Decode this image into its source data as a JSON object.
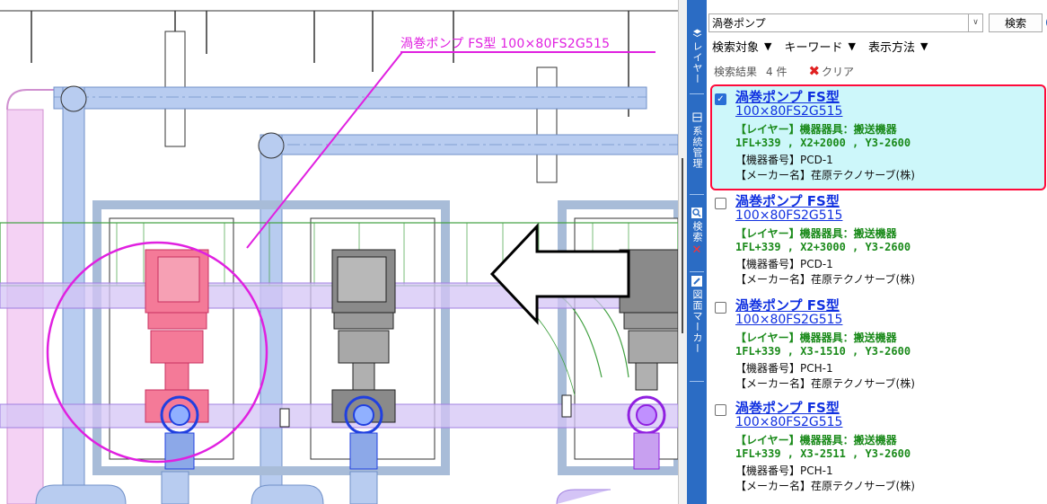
{
  "canvas": {
    "callout_label": "渦巻ポンプ FS型 100×80FS2G515",
    "colors": {
      "highlight": "#e020e0",
      "selected_pump": "#f07090",
      "pipe": "#a8c4ec",
      "duct": "#c8a8f0"
    }
  },
  "tabs": [
    {
      "label": "レイヤー",
      "icon": "layer-icon"
    },
    {
      "label": "系統管理",
      "icon": "system-icon"
    },
    {
      "label": "検索",
      "icon": "search-icon"
    },
    {
      "label": "図面マーカー",
      "icon": "marker-icon"
    }
  ],
  "search": {
    "query": "渦巻ポンプ",
    "button_label": "検索",
    "help_label": "?"
  },
  "filters": [
    {
      "label": "検索対象"
    },
    {
      "label": "キーワード"
    },
    {
      "label": "表示方法"
    }
  ],
  "results_header": {
    "label": "検索結果",
    "count": "4 件",
    "clear_label": "クリア"
  },
  "results": [
    {
      "title": "渦巻ポンプ FS型",
      "model": "100×80FS2G515",
      "layer": "【レイヤー】機器器具：搬送機器",
      "coord": "1FL+339 , X2+2000 , Y3-2600",
      "equip_no": "【機器番号】PCD-1",
      "maker": "【メーカー名】荏原テクノサーブ(株)",
      "checked": true
    },
    {
      "title": "渦巻ポンプ FS型",
      "model": "100×80FS2G515",
      "layer": "【レイヤー】機器器具：搬送機器",
      "coord": "1FL+339 , X2+3000 , Y3-2600",
      "equip_no": "【機器番号】PCD-1",
      "maker": "【メーカー名】荏原テクノサーブ(株)",
      "checked": false
    },
    {
      "title": "渦巻ポンプ FS型",
      "model": "100×80FS2G515",
      "layer": "【レイヤー】機器器具：搬送機器",
      "coord": "1FL+339 , X3-1510 , Y3-2600",
      "equip_no": "【機器番号】PCH-1",
      "maker": "【メーカー名】荏原テクノサーブ(株)",
      "checked": false
    },
    {
      "title": "渦巻ポンプ FS型",
      "model": "100×80FS2G515",
      "layer": "【レイヤー】機器器具：搬送機器",
      "coord": "1FL+339 , X3-2511 , Y3-2600",
      "equip_no": "【機器番号】PCH-1",
      "maker": "【メーカー名】荏原テクノサーブ(株)",
      "checked": false
    }
  ]
}
